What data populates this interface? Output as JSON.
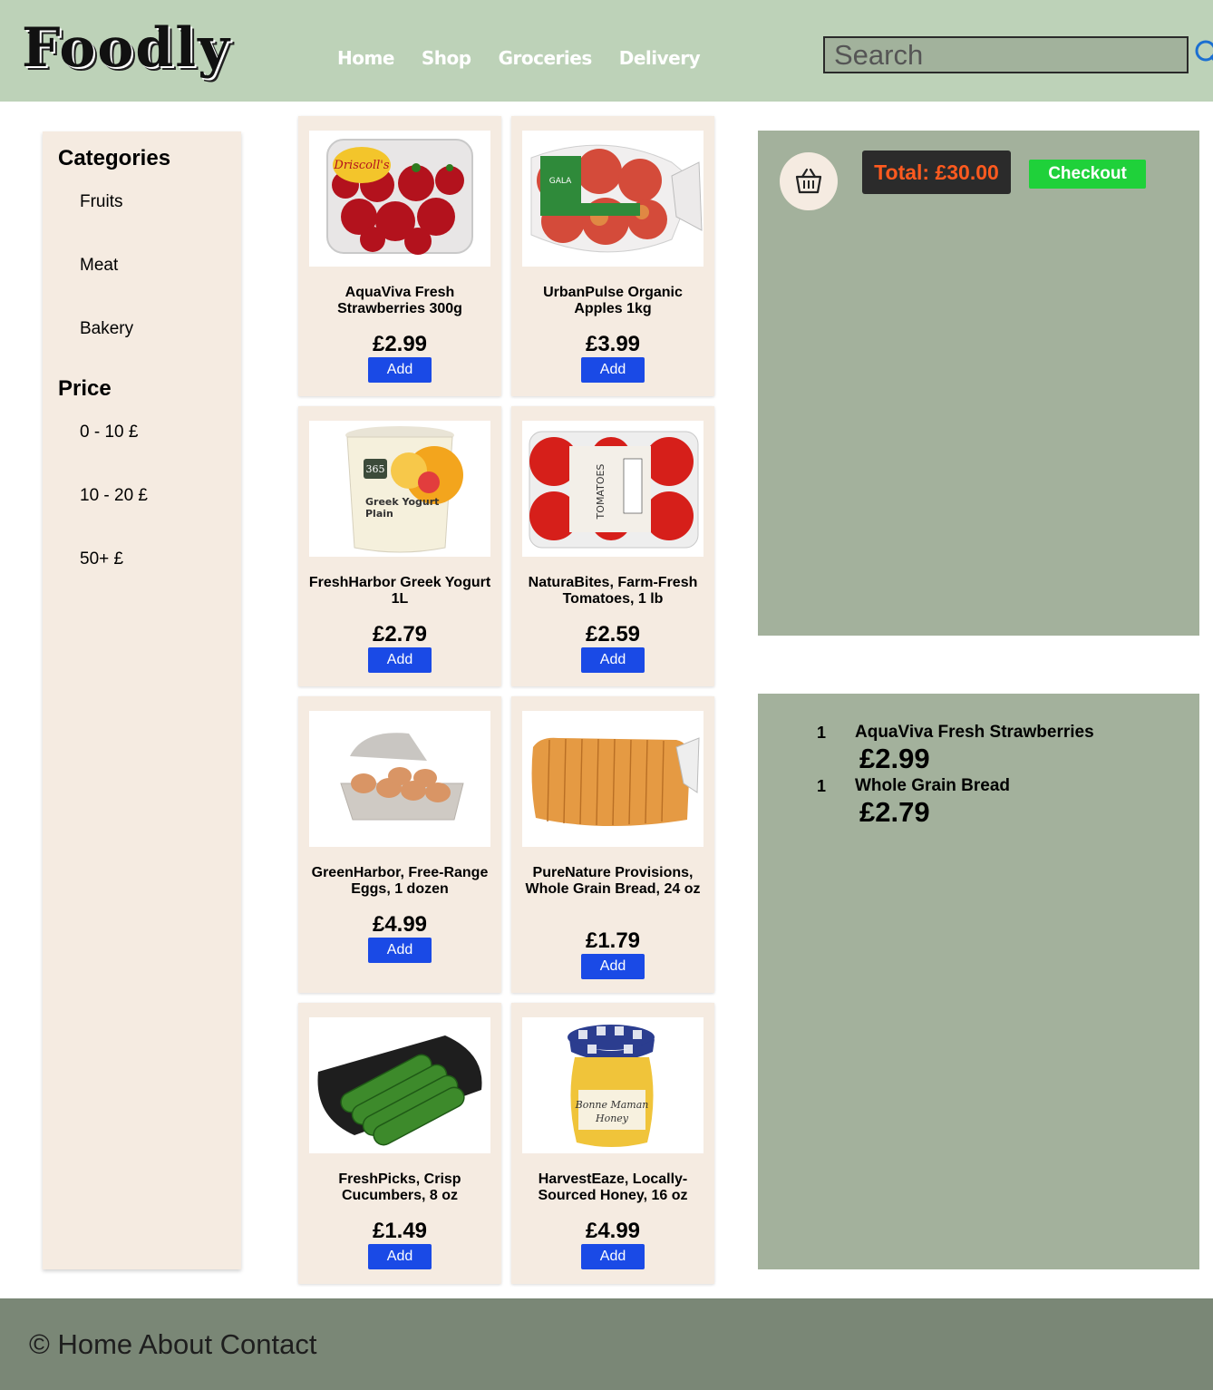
{
  "header": {
    "logo": "Foodly",
    "nav": [
      "Home",
      "Shop",
      "Groceries",
      "Delivery"
    ],
    "search_placeholder": "Search",
    "search_icon": "search-icon"
  },
  "sidebar": {
    "categories_title": "Categories",
    "categories": [
      "Fruits",
      "Meat",
      "Bakery"
    ],
    "price_title": "Price",
    "prices": [
      "0 - 10 £",
      "10 - 20 £",
      "50+ £"
    ]
  },
  "products": [
    {
      "name": "AquaViva Fresh Strawberries 300g",
      "price": "£2.99",
      "button": "Add",
      "icon": "strawberries"
    },
    {
      "name": "UrbanPulse Organic Apples 1kg",
      "price": "£3.99",
      "button": "Add",
      "icon": "apples"
    },
    {
      "name": "FreshHarbor Greek Yogurt 1L",
      "price": "£2.79",
      "button": "Add",
      "icon": "yogurt"
    },
    {
      "name": "NaturaBites, Farm-Fresh Tomatoes, 1 lb",
      "price": "£2.59",
      "button": "Add",
      "icon": "tomatoes"
    },
    {
      "name": "GreenHarbor, Free-Range Eggs, 1 dozen",
      "price": "£4.99",
      "button": "Add",
      "icon": "eggs"
    },
    {
      "name": "PureNature Provisions, Whole Grain Bread, 24 oz",
      "price": "£1.79",
      "button": "Add",
      "icon": "bread"
    },
    {
      "name": "FreshPicks, Crisp Cucumbers, 8 oz",
      "price": "£1.49",
      "button": "Add",
      "icon": "cucumbers"
    },
    {
      "name": "HarvestEaze, Locally-Sourced Honey, 16 oz",
      "price": "£4.99",
      "button": "Add",
      "icon": "honey"
    }
  ],
  "cart": {
    "icon": "basket-icon",
    "total": "Total: £30.00",
    "checkout": "Checkout",
    "items": [
      {
        "qty": "1",
        "name": "AquaViva Fresh Strawberries",
        "price": "£2.99"
      },
      {
        "qty": "1",
        "name": "Whole Grain Bread",
        "price": "£2.79"
      }
    ]
  },
  "footer": {
    "text": "© Home About Contact"
  },
  "colors": {
    "header_bg": "#bdd2b8",
    "card_bg": "#f5ebe1",
    "panel_bg": "#a3b19c",
    "add_button": "#1a4ae6",
    "checkout_button": "#1fd13a",
    "total_text": "#ff5a1f",
    "footer_bg": "#7a8776"
  }
}
